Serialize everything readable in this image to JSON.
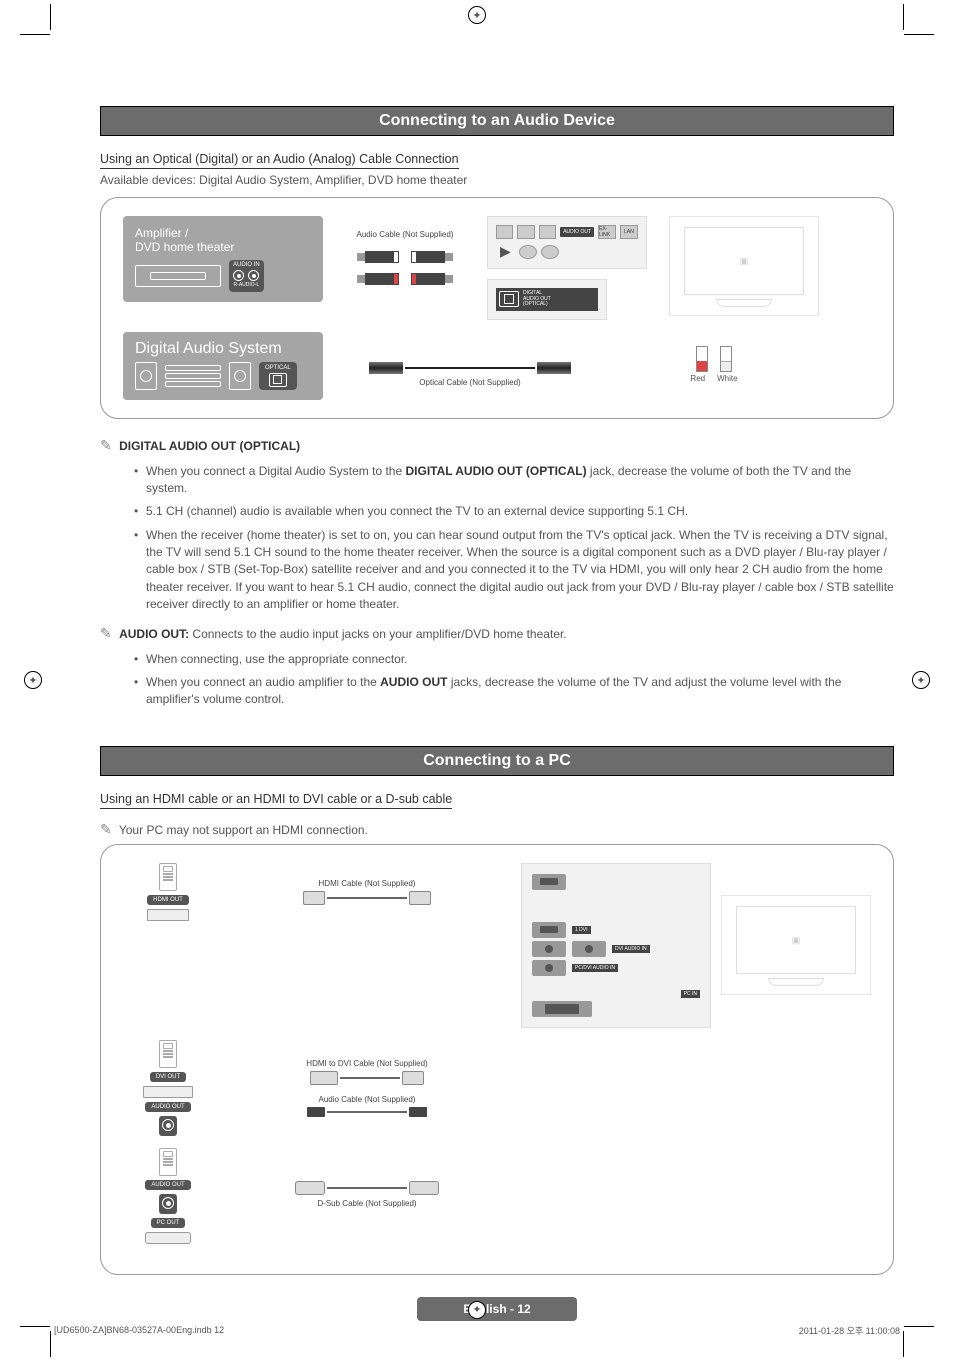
{
  "banners": {
    "audio": "Connecting to an Audio Device",
    "pc": "Connecting to a PC"
  },
  "audio": {
    "subheading": "Using an Optical (Digital) or an Audio (Analog) Cable Connection",
    "available": "Available devices: Digital Audio System, Amplifier, DVD home theater",
    "amp_label_line1": "Amplifier /",
    "amp_label_line2": "DVD home theater",
    "audio_in": "AUDIO IN",
    "r_audio_l": "R-AUDIO-L",
    "audio_cable": "Audio Cable (Not Supplied)",
    "das_label": "Digital Audio System",
    "optical": "OPTICAL",
    "optical_cable": "Optical Cable (Not Supplied)",
    "digital_out_badge_line1": "DIGITAL",
    "digital_out_badge_line2": "AUDIO OUT",
    "digital_out_badge_line3": "(OPTICAL)",
    "tv_ports": {
      "audio_out": "AUDIO\nOUT",
      "exlink": "EX-LINK",
      "lan": "LAN"
    },
    "red": "Red",
    "white": "White",
    "sec1_title": "DIGITAL AUDIO OUT (OPTICAL)",
    "sec1_bullets": [
      "When you connect a Digital Audio System to the DIGITAL AUDIO OUT (OPTICAL) jack, decrease the volume of both the TV and the system.",
      "5.1 CH (channel) audio is available when you connect the TV to an external device supporting 5.1 CH.",
      "When the receiver (home theater) is set to on, you can hear sound output from the TV's optical jack. When the TV is receiving a DTV signal, the TV will send 5.1 CH sound to the home theater receiver. When the source is a digital component such as a DVD player / Blu-ray player / cable box / STB (Set-Top-Box) satellite receiver and and you connected it to the TV via HDMI, you will only hear 2 CH audio from the home theater receiver. If you want to hear 5.1 CH audio, connect the digital audio out jack from your DVD / Blu-ray player / cable box / STB satellite receiver directly to an amplifier or home theater."
    ],
    "sec2_prefix": "AUDIO OUT:",
    "sec2_text": " Connects to the audio input jacks on your amplifier/DVD home theater.",
    "sec2_bullets": [
      "When connecting, use the appropriate connector.",
      "When you connect an audio amplifier to the AUDIO OUT jacks, decrease the volume of the TV and adjust the volume level with the amplifier's volume control."
    ]
  },
  "pc": {
    "subheading": "Using an HDMI cable or an HDMI to DVI cable or a D-sub cable",
    "note": "Your PC may not support an HDMI connection.",
    "hdmi_cable": "HDMI Cable (Not Supplied)",
    "hdmi_dvi_cable": "HDMI to DVI Cable (Not Supplied)",
    "audio_cable": "Audio Cable (Not Supplied)",
    "dsub_cable": "D-Sub Cable (Not Supplied)",
    "ports": {
      "hdmi_out": "HDMI OUT",
      "dvi_out": "DVI OUT",
      "audio_out": "AUDIO OUT",
      "pc_out": "PC OUT"
    },
    "tv_labels": {
      "hdmi1": "1 DVI",
      "dvi_audio": "DVI AUDIO IN",
      "pc_audio": "PC/DVI\nAUDIO IN",
      "pc_in": "PC IN"
    }
  },
  "footer": {
    "pill": "English - 12",
    "file": "[UD6500-ZA]BN68-03527A-00Eng.indb   12",
    "timestamp": "2011-01-28   오후 11:00:08"
  }
}
